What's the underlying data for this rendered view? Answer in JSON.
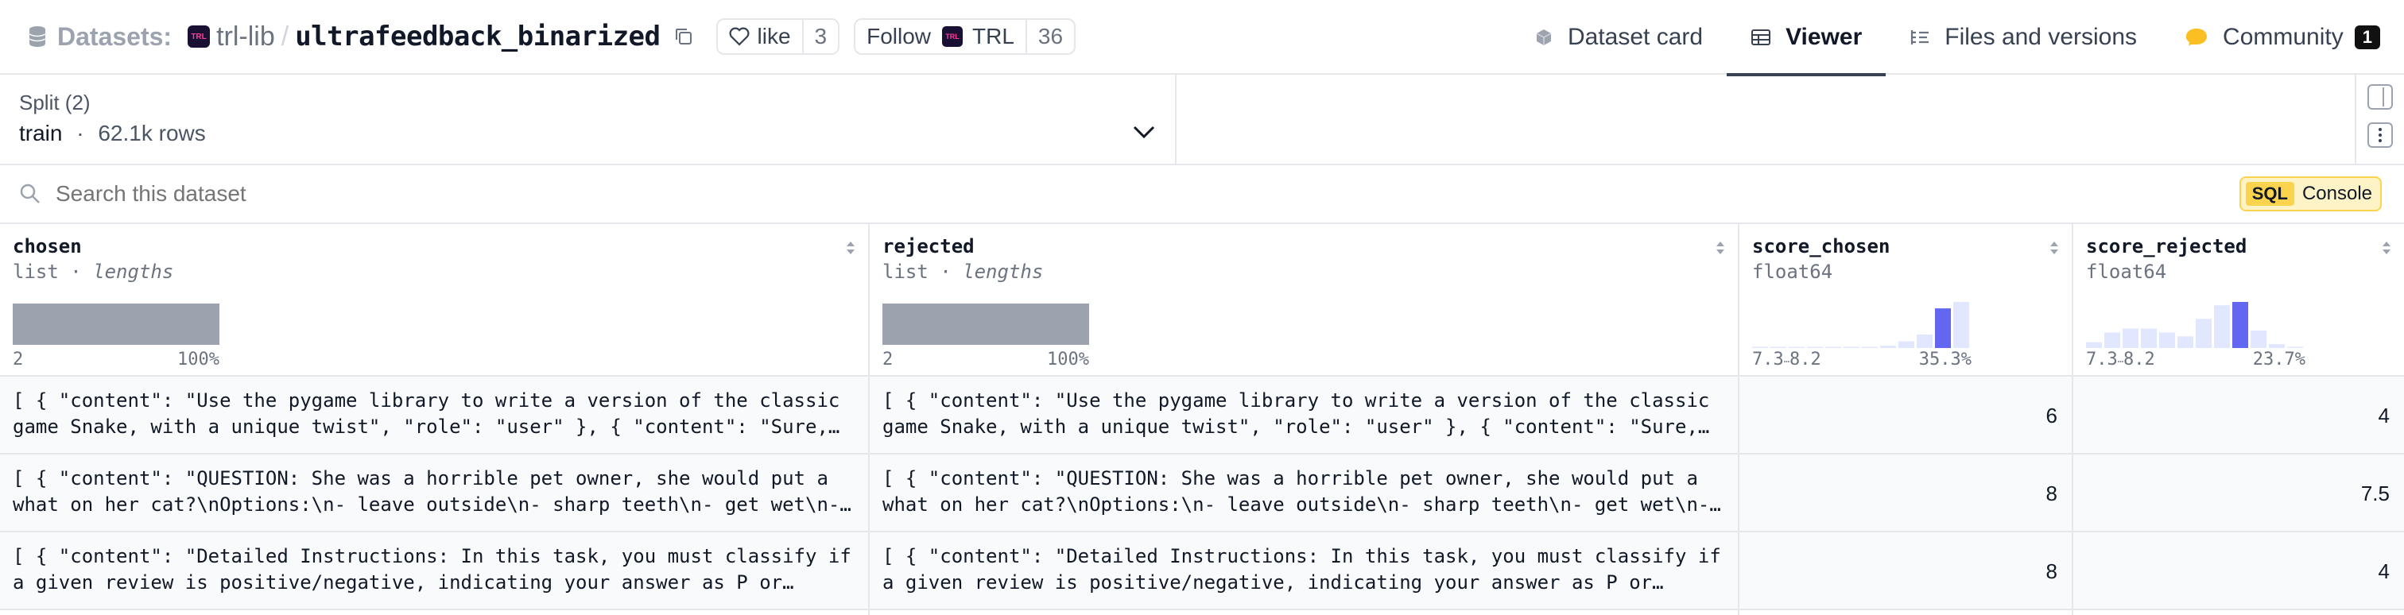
{
  "header": {
    "datasets_label": "Datasets:",
    "org": "trl-lib",
    "separator": "/",
    "repo": "ultrafeedback_binarized",
    "like_label": "like",
    "like_count": "3",
    "follow_label": "Follow",
    "follow_org": "TRL",
    "follow_count": "36",
    "tabs": [
      {
        "label": "Dataset card",
        "icon": "dataset-card-icon"
      },
      {
        "label": "Viewer",
        "icon": "table-icon"
      },
      {
        "label": "Files and versions",
        "icon": "files-icon"
      },
      {
        "label": "Community",
        "icon": "community-icon",
        "badge": "1"
      }
    ]
  },
  "split": {
    "label": "Split (2)",
    "value": "train",
    "separator": "·",
    "rows": "62.1k rows"
  },
  "search": {
    "placeholder": "Search this dataset",
    "sql_tag": "SQL",
    "sql_label": "Console"
  },
  "colors": {
    "accent_bar": "#6366f1",
    "light_bar": "#e0e7ff",
    "sql_bg": "#fef3c7",
    "len_bar": "#9ca3af"
  },
  "table": {
    "columns": [
      {
        "name": "chosen",
        "type": "list",
        "sep": " · ",
        "sub": "lengths",
        "min": "2",
        "max": "100%"
      },
      {
        "name": "rejected",
        "type": "list",
        "sep": " · ",
        "sub": "lengths",
        "min": "2",
        "max": "100%"
      },
      {
        "name": "score_chosen",
        "type": "float64",
        "min": "7.3",
        "dots": "⋯",
        "min2": "8.2",
        "max": "35.3%"
      },
      {
        "name": "score_rejected",
        "type": "float64",
        "min": "7.3",
        "dots": "⋯",
        "min2": "8.2",
        "max": "23.7%"
      }
    ],
    "rows": [
      {
        "chosen": [
          "[ { \"content\": \"Use the pygame library to write a version of the classic",
          "game Snake, with a unique twist\", \"role\": \"user\" }, { \"content\": \"Sure,…"
        ],
        "rejected": [
          "[ { \"content\": \"Use the pygame library to write a version of the classic",
          "game Snake, with a unique twist\", \"role\": \"user\" }, { \"content\": \"Sure,…"
        ],
        "score_chosen": "6",
        "score_rejected": "4"
      },
      {
        "chosen": [
          "[ { \"content\": \"QUESTION: She was a horrible pet owner, she would put a",
          "what on her cat?\\nOptions:\\n- leave outside\\n- sharp teeth\\n- get wet\\n-…"
        ],
        "rejected": [
          "[ { \"content\": \"QUESTION: She was a horrible pet owner, she would put a",
          "what on her cat?\\nOptions:\\n- leave outside\\n- sharp teeth\\n- get wet\\n-…"
        ],
        "score_chosen": "8",
        "score_rejected": "7.5"
      },
      {
        "chosen": [
          "[ { \"content\": \"Detailed Instructions: In this task, you must classify if",
          "a given review is positive/negative, indicating your answer as P or…"
        ],
        "rejected": [
          "[ { \"content\": \"Detailed Instructions: In this task, you must classify if",
          "a given review is positive/negative, indicating your answer as P or…"
        ],
        "score_chosen": "8",
        "score_rejected": "4"
      }
    ]
  },
  "chart_data": [
    {
      "type": "bar",
      "title": "score_chosen",
      "bins": 12,
      "values": [
        0.5,
        0.5,
        0.5,
        0.5,
        0.5,
        0.5,
        0.5,
        2,
        6,
        12,
        35.3,
        41
      ],
      "highlight_index": 10,
      "xlabel_min": "7.3",
      "xlabel_mid": "8.2",
      "top_label": "35.3%"
    },
    {
      "type": "bar",
      "title": "score_rejected",
      "bins": 12,
      "values": [
        3,
        8,
        10,
        10,
        8,
        6,
        15,
        22,
        23.7,
        9,
        2,
        0.5
      ],
      "highlight_index": 8,
      "xlabel_min": "7.3",
      "xlabel_mid": "8.2",
      "top_label": "23.7%"
    }
  ]
}
